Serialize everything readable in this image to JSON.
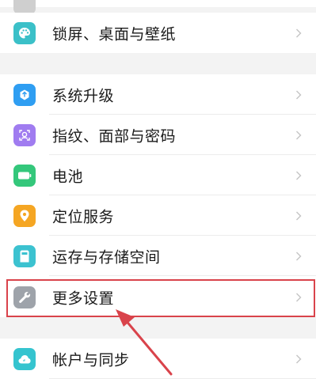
{
  "groups": [
    {
      "items": [
        {
          "label": "锁屏、桌面与壁纸",
          "icon": "palette-icon",
          "color": "#3bc0c8"
        }
      ]
    },
    {
      "items": [
        {
          "label": "系统升级",
          "icon": "system-update-icon",
          "color": "#2f9ef2"
        },
        {
          "label": "指纹、面部与密码",
          "icon": "fingerprint-face-icon",
          "color": "#a07cf0"
        },
        {
          "label": "电池",
          "icon": "battery-icon",
          "color": "#34c77b"
        },
        {
          "label": "定位服务",
          "icon": "location-pin-icon",
          "color": "#f5a623"
        },
        {
          "label": "运存与存储空间",
          "icon": "storage-icon",
          "color": "#3cc2d0"
        },
        {
          "label": "更多设置",
          "icon": "wrench-icon",
          "color": "#9ea3aa"
        }
      ]
    },
    {
      "items": [
        {
          "label": "帐户与同步",
          "icon": "cloud-sync-icon",
          "color": "#35c4cf"
        }
      ]
    }
  ],
  "annotation": {
    "highlighted_item": "更多设置",
    "highlight_color": "#d9434b"
  }
}
